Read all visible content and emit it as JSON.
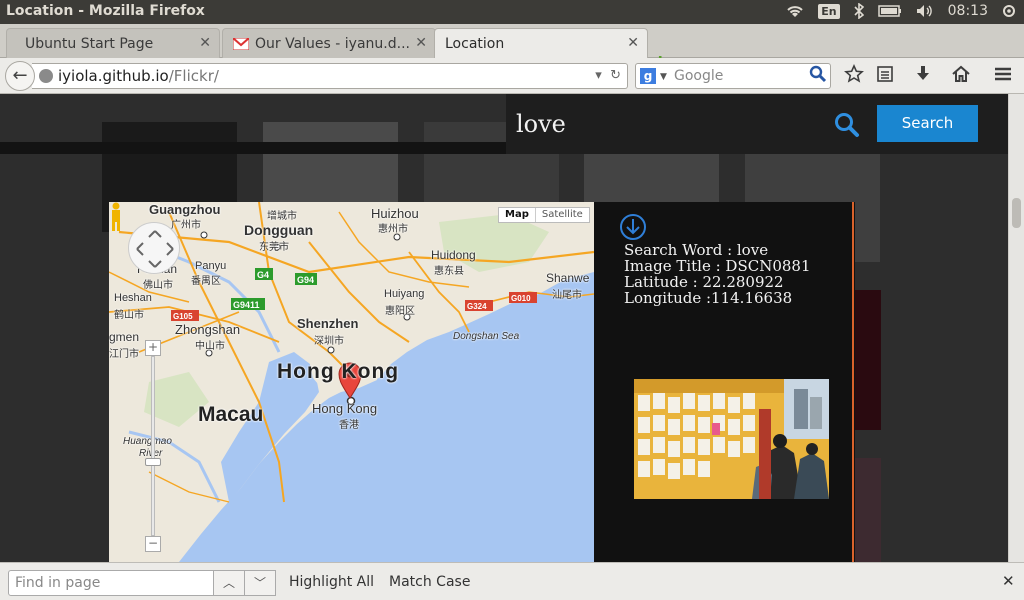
{
  "system": {
    "window_title": "Location - Mozilla Firefox",
    "keyboard_layout": "En",
    "clock": "08:13"
  },
  "tabs": [
    {
      "label": "Ubuntu Start Page",
      "active": false
    },
    {
      "label": "Our Values - iyanu.d...",
      "active": false
    },
    {
      "label": "Location",
      "active": true
    }
  ],
  "navbar": {
    "url_host": "iyiola.github.io",
    "url_path": "/Flickr/",
    "search_engine_placeholder": "Google"
  },
  "page": {
    "search": {
      "query": "love",
      "button_label": "Search"
    },
    "map": {
      "type_map": "Map",
      "type_satellite": "Satellite",
      "places": {
        "guangzhou": "Guangzhou",
        "guangzhou_cn": "广州市",
        "zengcheng": "增城市",
        "huizhou": "Huizhou",
        "huizhou_cn": "惠州市",
        "dongguan": "Dongguan",
        "dongguan_cn": "东莞市",
        "huidong": "Huidong",
        "huidong_cn": "惠东县",
        "panyu": "Panyu",
        "panyu_cn": "番禺区",
        "foshan": "Foshan",
        "foshan_cn": "佛山市",
        "heshan": "Heshan",
        "heshan_cn": "鹤山市",
        "zhongshan": "Zhongshan",
        "zhongshan_cn": "中山市",
        "jiangmen": "gmen",
        "jiangmen_cn": "江门市",
        "shenzhen": "Shenzhen",
        "shenzhen_cn": "深圳市",
        "huiyang": "Huiyang",
        "huiyang_cn": "惠阳区",
        "shanwei": "Shanwe",
        "shanwei_cn": "汕尾市",
        "hongkong_big": "Hong Kong",
        "hongkong": "Hong Kong",
        "hongkong_cn": "香港",
        "macau": "Macau",
        "huangmao": "Huangmao",
        "river": "River",
        "dongshan_sea": "Dongshan Sea"
      },
      "shields": [
        "G4",
        "G94",
        "G9411",
        "G105",
        "G324",
        "G010"
      ]
    },
    "info": {
      "search_word_line": "Search Word : love",
      "image_title_line": "Image Title : DSCN0881",
      "latitude_line": "Latitude : 22.280922",
      "longitude_line": "Longitude :114.16638"
    }
  },
  "findbar": {
    "placeholder": "Find in page",
    "highlight_all": "Highlight All",
    "match_case": "Match Case"
  },
  "colors": {
    "search_button": "#1a86d0",
    "modal_divider": "#d9622b",
    "map_water": "#a7c6f2",
    "map_land": "#ede8dc"
  }
}
